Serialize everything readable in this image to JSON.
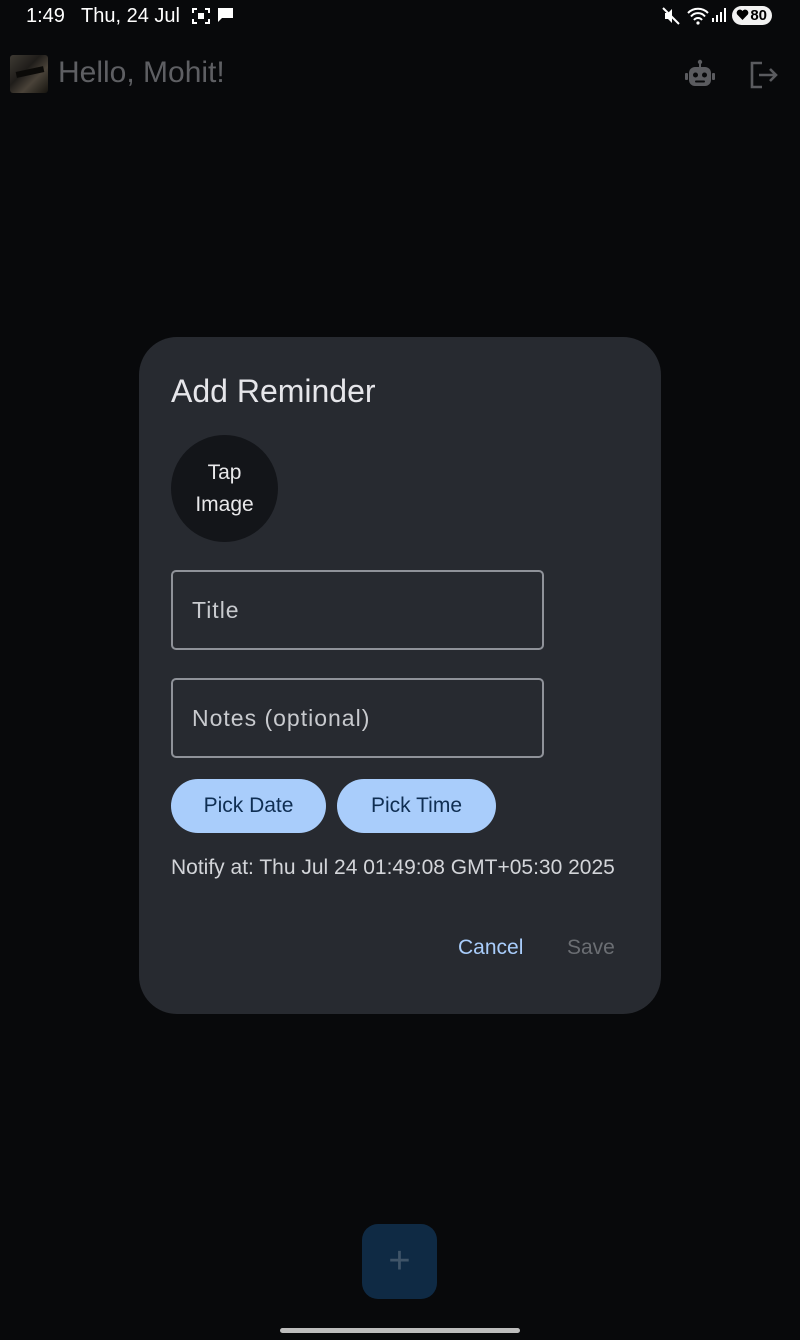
{
  "status_bar": {
    "time": "1:49",
    "date": "Thu, 24 Jul",
    "battery": "80",
    "icons": [
      "screenshot-icon",
      "message-icon",
      "mute-icon",
      "wifi-icon",
      "signal-icon",
      "battery-icon"
    ]
  },
  "app_bar": {
    "greeting": "Hello, Mohit!",
    "actions": [
      "robot-icon",
      "logout-icon"
    ]
  },
  "dialog": {
    "title": "Add Reminder",
    "image_picker_label": "Tap Image",
    "title_placeholder": "Title",
    "notes_placeholder": "Notes (optional)",
    "pick_date_label": "Pick Date",
    "pick_time_label": "Pick Time",
    "notify_text": "Notify at: Thu Jul 24 01:49:08 GMT+05:30 2025",
    "cancel_label": "Cancel",
    "save_label": "Save"
  },
  "fab": {
    "label": "+"
  },
  "colors": {
    "background": "#08090b",
    "dialog": "#272a30",
    "accent": "#a9cdfb",
    "fab": "#0f2a44"
  }
}
